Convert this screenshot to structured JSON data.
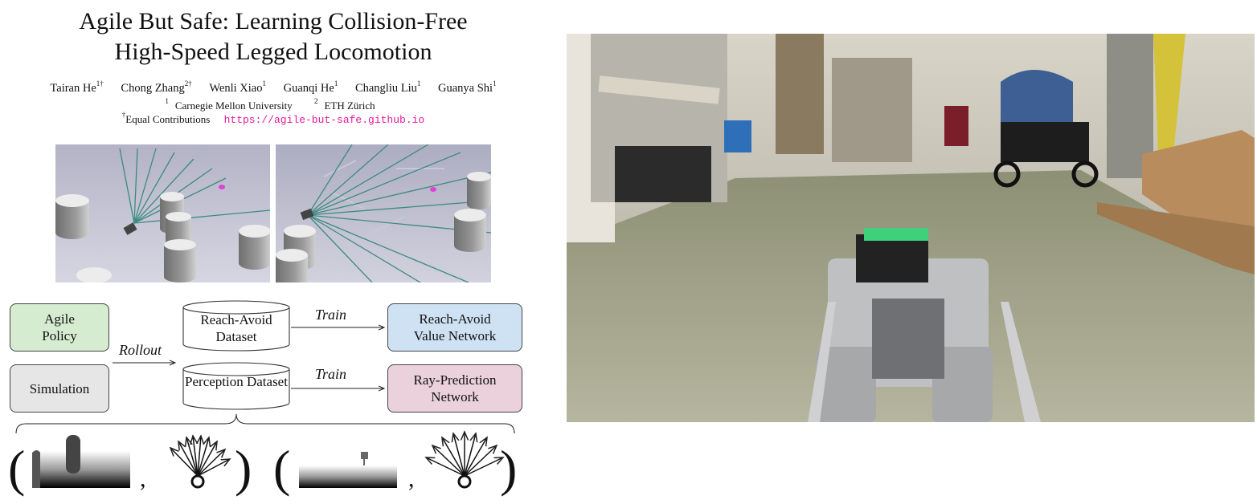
{
  "paper": {
    "title_line1": "Agile But Safe: Learning Collision-Free",
    "title_line2": "High-Speed Legged Locomotion",
    "authors": [
      {
        "name": "Tairan He",
        "sup": "1†"
      },
      {
        "name": "Chong Zhang",
        "sup": "2†"
      },
      {
        "name": "Wenli Xiao",
        "sup": "1"
      },
      {
        "name": "Guanqi He",
        "sup": "1"
      },
      {
        "name": "Changliu Liu",
        "sup": "1"
      },
      {
        "name": "Guanya Shi",
        "sup": "1"
      }
    ],
    "affiliations": [
      {
        "sup": "1",
        "name": "Carnegie Mellon University"
      },
      {
        "sup": "2",
        "name": "ETH Zürich"
      }
    ],
    "contrib_sup": "†",
    "contrib_text": "Equal Contributions",
    "url": "https://agile-but-safe.github.io"
  },
  "diagram": {
    "agile_policy": "Agile Policy",
    "simulation": "Simulation",
    "rollout": "Rollout",
    "reach_avoid_dataset": "Reach-Avoid Dataset",
    "perception_dataset": "Perception Dataset",
    "train1": "Train",
    "train2": "Train",
    "reach_avoid_network": "Reach-Avoid Value Network",
    "ray_prediction_network": "Ray-Prediction Network",
    "comma": ",",
    "colors": {
      "agile_policy_fill": "#d5ecd0",
      "simulation_fill": "#e6e6e6",
      "reach_avoid_network_fill": "#cfe2f3",
      "ray_network_fill": "#ead1dc",
      "url": "#e8189a",
      "rays": "#3d8a80"
    }
  }
}
